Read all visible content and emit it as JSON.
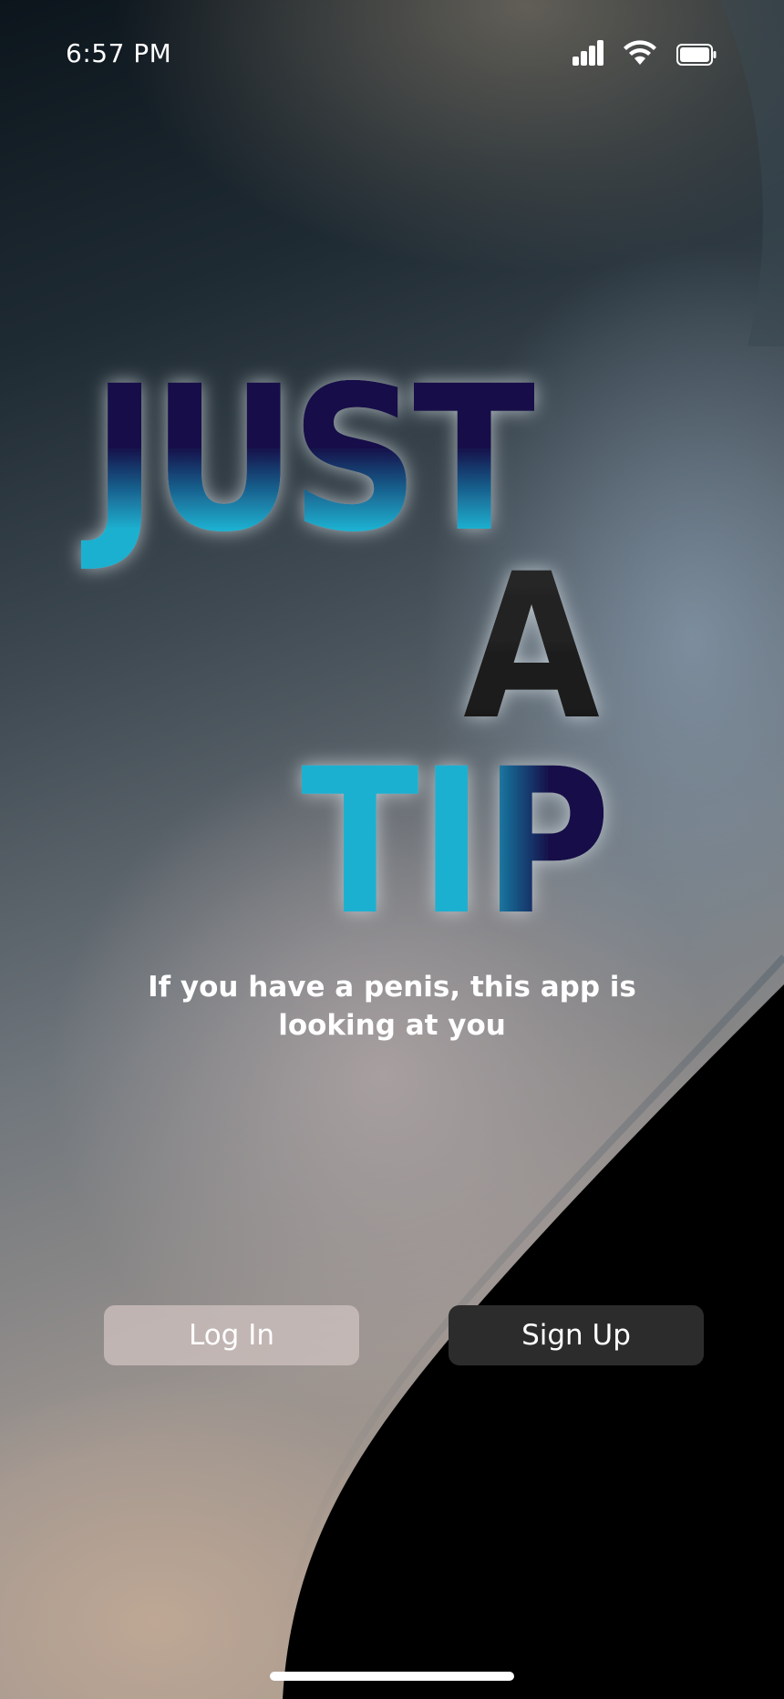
{
  "status_bar": {
    "time": "6:57 PM",
    "icons": [
      "cellular-signal-icon",
      "wifi-icon",
      "battery-icon"
    ]
  },
  "logo": {
    "lines": [
      "JUST",
      "A",
      "TIP"
    ],
    "colors": {
      "dark": "#1e1e1e",
      "navy": "#12104a",
      "cyan": "#1fb0d0"
    }
  },
  "tagline": {
    "line1": "If you have a penis, this app is",
    "line2": "looking at you"
  },
  "buttons": {
    "login_label": "Log In",
    "signup_label": "Sign Up"
  }
}
